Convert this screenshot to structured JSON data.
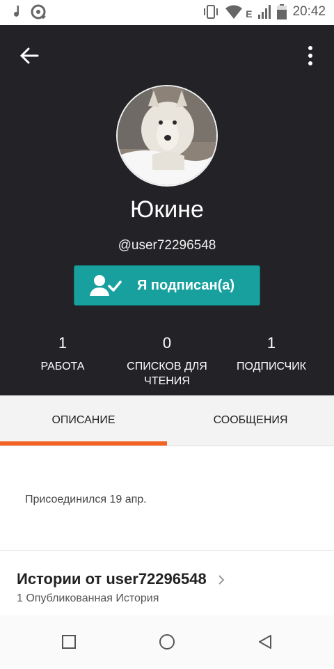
{
  "status": {
    "time": "20:42",
    "network": "E"
  },
  "profile": {
    "name": "Юкине",
    "handle": "@user72296548",
    "follow_label": "Я подписан(а)"
  },
  "stats": [
    {
      "num": "1",
      "label": "РАБОТА"
    },
    {
      "num": "0",
      "label": "СПИСКОВ ДЛЯ ЧТЕНИЯ"
    },
    {
      "num": "1",
      "label": "ПОДПИСЧИК"
    }
  ],
  "tabs": [
    {
      "label": "ОПИСАНИЕ",
      "active": true
    },
    {
      "label": "СООБЩЕНИЯ",
      "active": false
    }
  ],
  "about": {
    "joined": "Присоединился 19 апр."
  },
  "stories": {
    "title": "Истории от user72296548",
    "count": "1 Опубликованная История"
  },
  "colors": {
    "header": "#232227",
    "accent": "#f26222",
    "follow": "#18a09f"
  },
  "icons": [
    "music-note-icon",
    "download-icon",
    "vibrate-icon",
    "wifi-icon",
    "signal-icon",
    "battery-icon",
    "back-arrow-icon",
    "more-vert-icon",
    "user-check-icon",
    "chevron-right-icon",
    "nav-square-icon",
    "nav-circle-icon",
    "nav-back-icon"
  ]
}
